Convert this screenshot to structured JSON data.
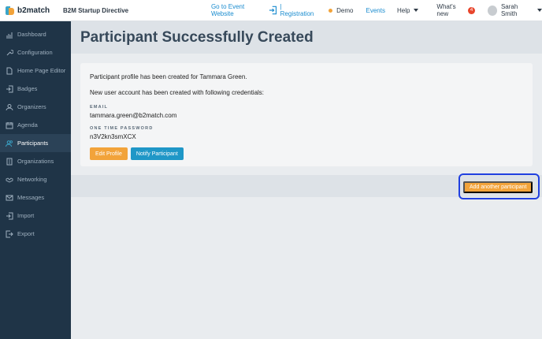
{
  "header": {
    "brand": "b2match",
    "event_name": "B2M Startup Directive",
    "go_to_event": "Go to Event Website",
    "registration": "| Registration",
    "demo": "Demo",
    "events": "Events",
    "help": "Help",
    "whats_new": "What's new",
    "whats_new_count": "4",
    "user_name": "Sarah Smith",
    "colors": {
      "link": "#1a8ccf",
      "demo_dot": "#f2a33a",
      "badge": "#e8452c"
    }
  },
  "sidebar": {
    "items": [
      {
        "label": "Dashboard",
        "icon": "chart-icon"
      },
      {
        "label": "Configuration",
        "icon": "wrench-icon"
      },
      {
        "label": "Home Page Editor",
        "icon": "document-icon"
      },
      {
        "label": "Badges",
        "icon": "login-icon"
      },
      {
        "label": "Organizers",
        "icon": "user-icon"
      },
      {
        "label": "Agenda",
        "icon": "calendar-icon"
      },
      {
        "label": "Participants",
        "icon": "users-icon",
        "active": true
      },
      {
        "label": "Organizations",
        "icon": "building-icon"
      },
      {
        "label": "Networking",
        "icon": "handshake-icon"
      },
      {
        "label": "Messages",
        "icon": "mail-icon"
      },
      {
        "label": "Import",
        "icon": "import-icon"
      },
      {
        "label": "Export",
        "icon": "export-icon"
      }
    ],
    "colors": {
      "background": "#1f3447",
      "active": "#2b4257"
    }
  },
  "main": {
    "title": "Participant Successfully Created",
    "profile_msg": "Participant profile has been created for Tammara Green.",
    "account_msg": "New user account has been created with following credentials:",
    "email_label": "EMAIL",
    "email_value": "tammara.green@b2match.com",
    "otp_label": "ONE TIME PASSWORD",
    "otp_value": "n3V2kn3smXCX",
    "edit_profile": "Edit Profile",
    "notify_participant": "Notify Participant",
    "add_another": "Add another participant",
    "colors": {
      "orange": "#f2a33a",
      "blue": "#1f97c7",
      "highlight": "#2040e0"
    }
  }
}
